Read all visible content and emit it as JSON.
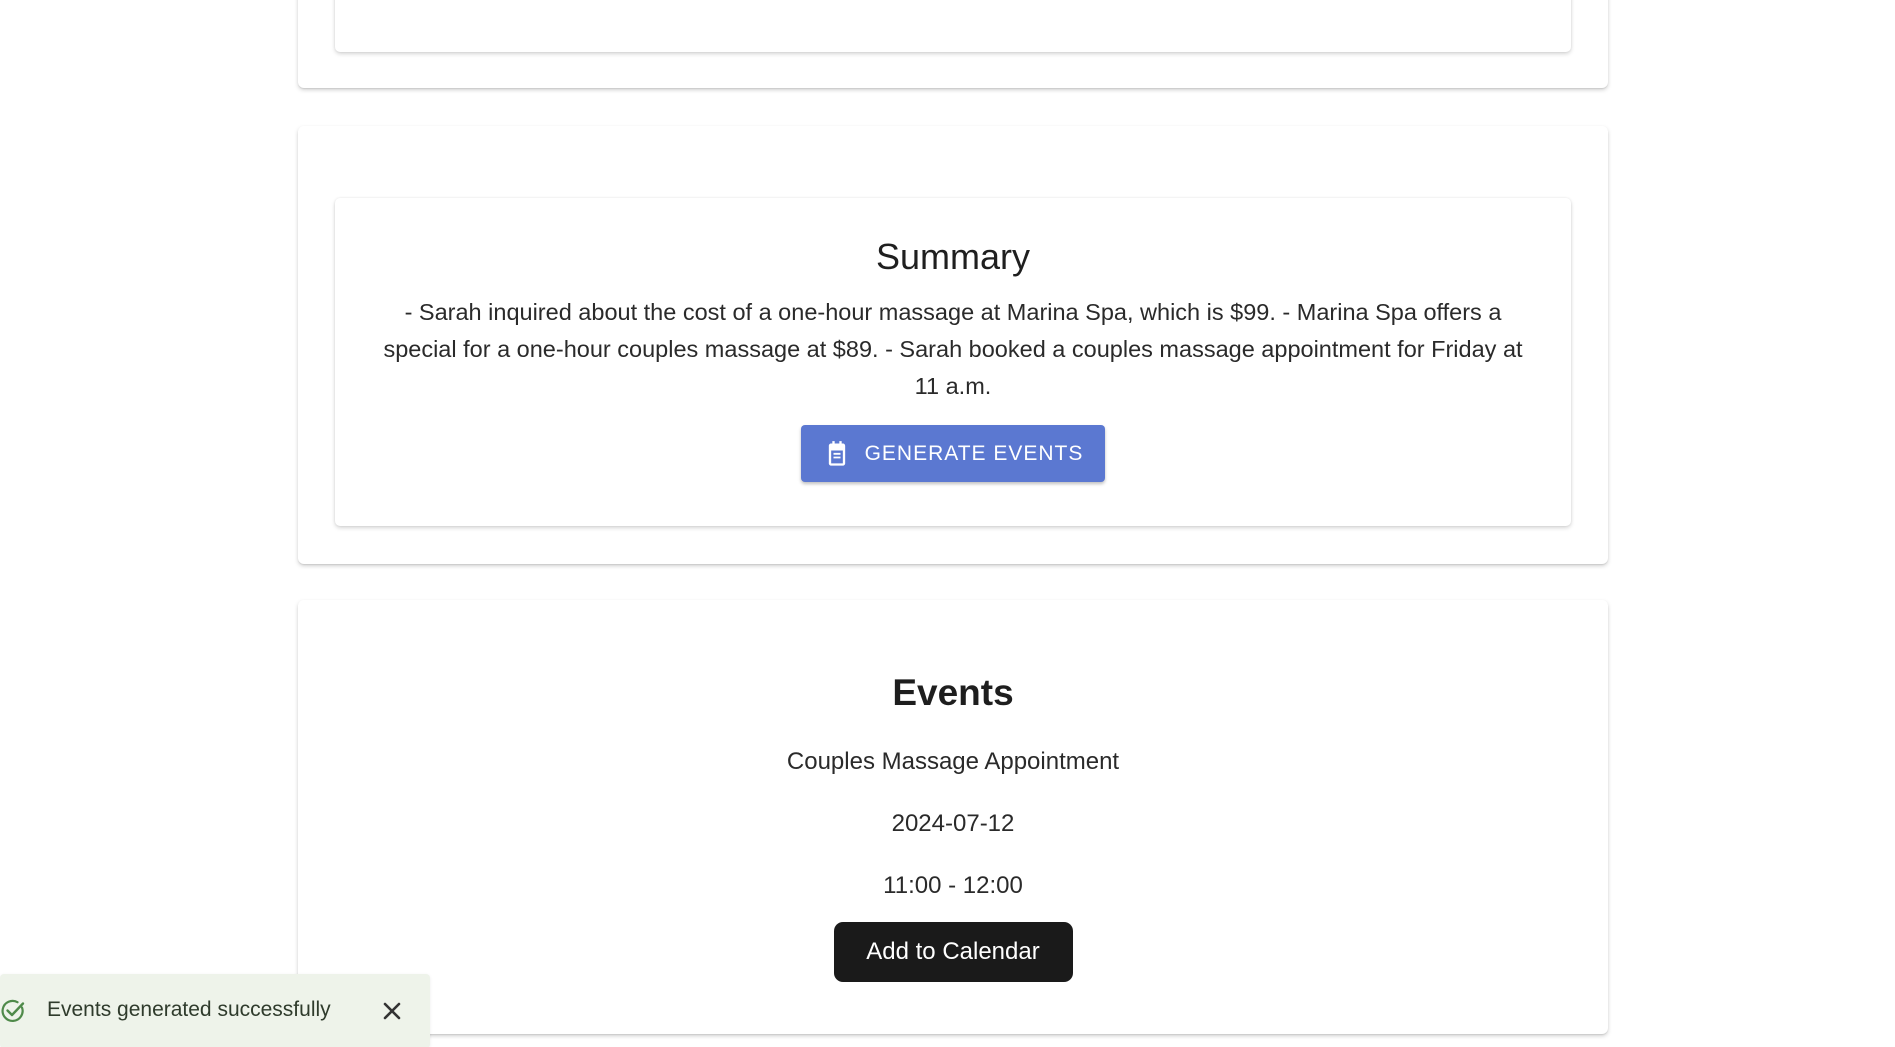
{
  "summary": {
    "title": "Summary",
    "text": "- Sarah inquired about the cost of a one-hour massage at Marina Spa, which is $99. - Marina Spa offers a special for a one-hour couples massage at $89. - Sarah booked a couples massage appointment for Friday at 11 a.m.",
    "generate_button": {
      "label": "GENERATE EVENTS",
      "icon": "calendar-icon",
      "color": "#5b78d1"
    }
  },
  "events": {
    "title": "Events",
    "items": [
      {
        "name": "Couples Massage Appointment",
        "date": "2024-07-12",
        "time": "11:00 - 12:00"
      }
    ],
    "add_button": {
      "label": "Add to Calendar",
      "color": "#1a1a1a"
    }
  },
  "toast": {
    "message": "Events generated successfully",
    "status_icon": "check-circle-icon",
    "close_icon": "close-icon",
    "background": "#eef3ea",
    "icon_color": "#4f8a4a"
  }
}
